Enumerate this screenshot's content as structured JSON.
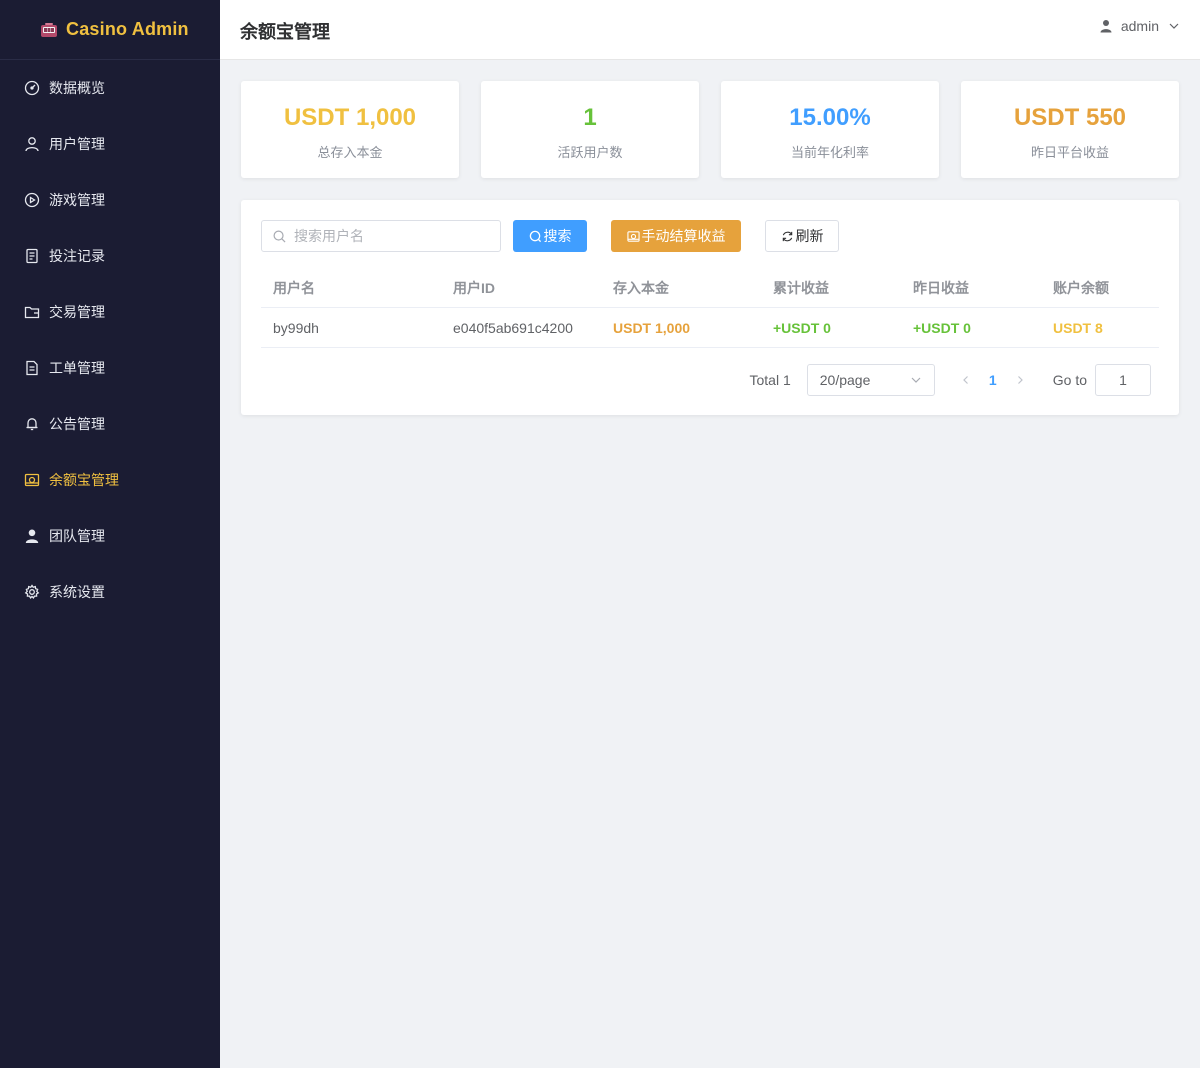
{
  "app": {
    "title": "Casino Admin"
  },
  "sidebar": {
    "items": [
      {
        "label": "数据概览",
        "icon": "dashboard-icon"
      },
      {
        "label": "用户管理",
        "icon": "user-icon"
      },
      {
        "label": "游戏管理",
        "icon": "play-icon"
      },
      {
        "label": "投注记录",
        "icon": "document-icon"
      },
      {
        "label": "交易管理",
        "icon": "wallet-icon"
      },
      {
        "label": "工单管理",
        "icon": "ticket-icon"
      },
      {
        "label": "公告管理",
        "icon": "bell-icon"
      },
      {
        "label": "余额宝管理",
        "icon": "money-icon",
        "active": true
      },
      {
        "label": "团队管理",
        "icon": "team-icon"
      },
      {
        "label": "系统设置",
        "icon": "gear-icon"
      }
    ]
  },
  "header": {
    "title": "余额宝管理",
    "username": "admin"
  },
  "stats": [
    {
      "value": "USDT 1,000",
      "label": "总存入本金",
      "color": "#f0c040"
    },
    {
      "value": "1",
      "label": "活跃用户数",
      "color": "#67c23a"
    },
    {
      "value": "15.00%",
      "label": "当前年化利率",
      "color": "#409eff"
    },
    {
      "value": "USDT 550",
      "label": "昨日平台收益",
      "color": "#e6a23c"
    }
  ],
  "toolbar": {
    "search_placeholder": "搜索用户名",
    "search_label": "搜索",
    "settle_label": "手动结算收益",
    "refresh_label": "刷新"
  },
  "table": {
    "columns": [
      "用户名",
      "用户ID",
      "存入本金",
      "累计收益",
      "昨日收益",
      "账户余额"
    ],
    "rows": [
      {
        "username": "by99dh",
        "user_id": "e040f5ab691c4200",
        "principal": "USDT 1,000",
        "total_earnings": "+USDT 0",
        "yesterday_earnings": "+USDT 0",
        "balance": "USDT 8"
      }
    ]
  },
  "pagination": {
    "total_label": "Total 1",
    "page_size": "20/page",
    "current_page": "1",
    "goto_label": "Go to",
    "goto_value": "1"
  }
}
